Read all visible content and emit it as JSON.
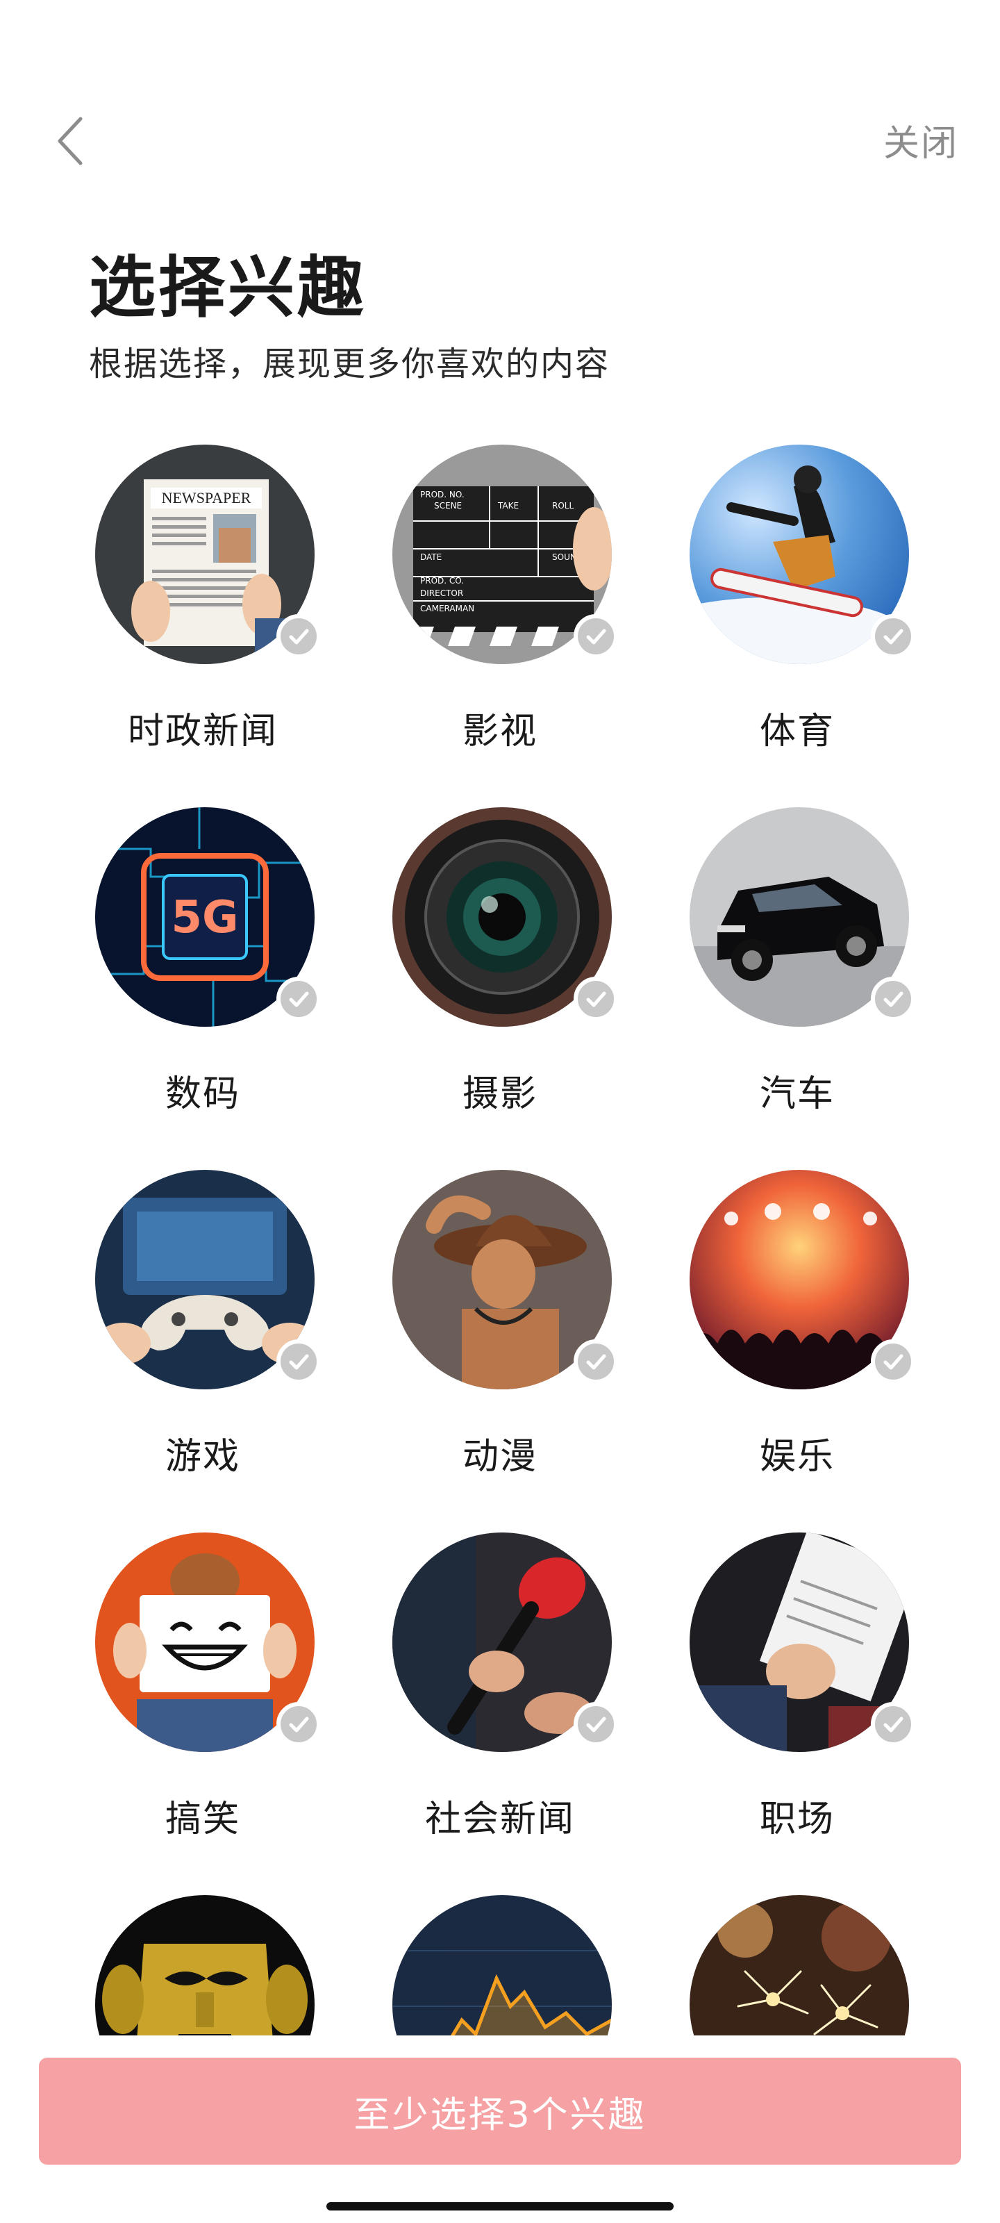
{
  "header": {
    "back_icon": "chevron-left-icon",
    "close_label": "关闭"
  },
  "page": {
    "title": "选择兴趣",
    "subtitle": "根据选择，展现更多你喜欢的内容"
  },
  "interests": [
    {
      "label": "时政新闻",
      "icon": "newspaper-image",
      "selected": false
    },
    {
      "label": "影视",
      "icon": "clapperboard-image",
      "selected": false
    },
    {
      "label": "体育",
      "icon": "snowboard-image",
      "selected": false
    },
    {
      "label": "数码",
      "icon": "5g-chip-image",
      "selected": false
    },
    {
      "label": "摄影",
      "icon": "camera-lens-image",
      "selected": false
    },
    {
      "label": "汽车",
      "icon": "suv-image",
      "selected": false
    },
    {
      "label": "游戏",
      "icon": "game-controller-image",
      "selected": false
    },
    {
      "label": "动漫",
      "icon": "anime-figure-image",
      "selected": false
    },
    {
      "label": "娱乐",
      "icon": "concert-image",
      "selected": false
    },
    {
      "label": "搞笑",
      "icon": "smile-sign-image",
      "selected": false
    },
    {
      "label": "社会新闻",
      "icon": "microphone-image",
      "selected": false
    },
    {
      "label": "职场",
      "icon": "contract-signing-image",
      "selected": false
    },
    {
      "label": "",
      "icon": "golden-mask-image",
      "selected": false
    },
    {
      "label": "",
      "icon": "stock-chart-image",
      "selected": false
    },
    {
      "label": "",
      "icon": "sparklers-image",
      "selected": false
    }
  ],
  "cta": {
    "label": "至少选择3个兴趣"
  },
  "colors": {
    "cta_bg": "#f6a1a3",
    "check_bg": "#c8c8c8",
    "close_text": "#8c8c8c"
  }
}
